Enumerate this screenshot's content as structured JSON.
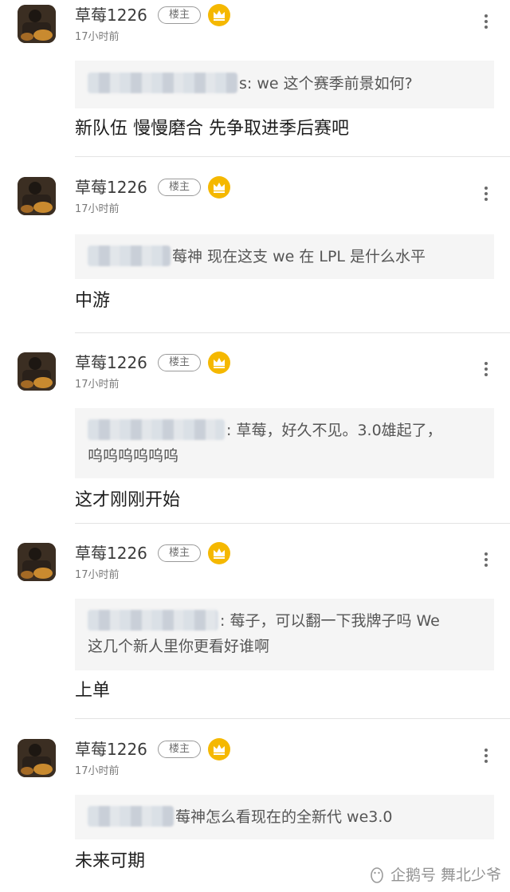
{
  "comments": [
    {
      "author": "草莓1226",
      "badge": "楼主",
      "time": "17小时前",
      "quote_text": "s: we 这个赛季前景如何?",
      "reply": "新队伍 慢慢磨合 先争取进季后赛吧"
    },
    {
      "author": "草莓1226",
      "badge": "楼主",
      "time": "17小时前",
      "quote_text": "莓神 现在这支 we 在 LPL 是什么水平",
      "reply": "中游"
    },
    {
      "author": "草莓1226",
      "badge": "楼主",
      "time": "17小时前",
      "quote_text": ": 草莓，好久不见。3.0雄起了，",
      "quote_text_2": "呜呜呜呜呜呜",
      "reply": "这才刚刚开始"
    },
    {
      "author": "草莓1226",
      "badge": "楼主",
      "time": "17小时前",
      "quote_text": ": 莓子，可以翻一下我牌子吗 We",
      "quote_text_2": "这几个新人里你更看好谁啊",
      "reply": "上单"
    },
    {
      "author": "草莓1226",
      "badge": "楼主",
      "time": "17小时前",
      "quote_text": "莓神怎么看现在的全新代 we3.0",
      "reply": "未来可期"
    }
  ],
  "watermark": "企鹅号 舞北少爷",
  "colors": {
    "crown": "#f5b800",
    "quote_bg": "#f5f5f5",
    "divider": "#e3e3e3"
  },
  "icons": {
    "crown": "crown-icon",
    "more": "more-vertical-icon",
    "avatar": "avatar-image"
  }
}
